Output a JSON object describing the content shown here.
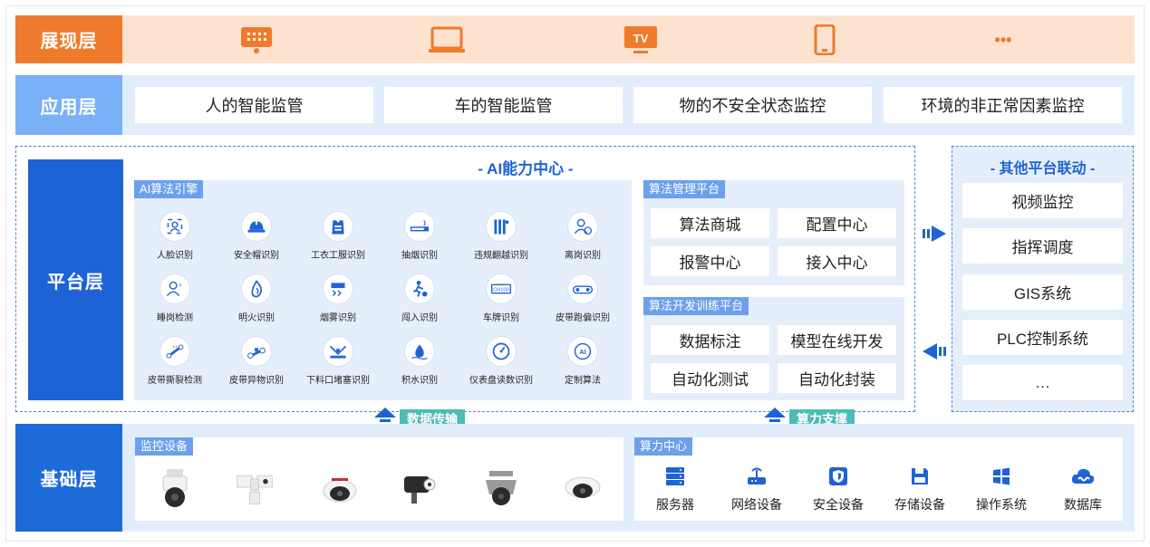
{
  "layers": {
    "presentation": "展现层",
    "application": "应用层",
    "platform": "平台层",
    "foundation": "基础层"
  },
  "presentation_devices": [
    "large-screen-icon",
    "laptop-icon",
    "tv-icon",
    "phone-icon",
    "more-icon"
  ],
  "presentation_tv_text": "TV",
  "presentation_more_text": "•••",
  "application_items": [
    "人的智能监管",
    "车的智能监管",
    "物的不安全状态监控",
    "环境的非正常因素监控"
  ],
  "ai_center": {
    "title": "- AI能力中心 -",
    "engine": {
      "tag": "AI算法引擎",
      "items": [
        "人脸识别",
        "安全帽识别",
        "工衣工服识别",
        "抽烟识别",
        "违规翻越识别",
        "离岗识别",
        "睡岗检测",
        "明火识别",
        "烟雾识别",
        "闯入识别",
        "车牌识别",
        "皮带跑偏识别",
        "皮带撕裂检测",
        "皮带异物识别",
        "下料口堵塞识别",
        "积水识别",
        "仪表盘读数识别",
        "定制算法"
      ],
      "plate_text": "CH100",
      "custom_text": "AI"
    },
    "management": {
      "tag": "算法管理平台",
      "items": [
        "算法商城",
        "配置中心",
        "报警中心",
        "接入中心"
      ]
    },
    "training": {
      "tag": "算法开发训练平台",
      "items": [
        "数据标注",
        "模型在线开发",
        "自动化测试",
        "自动化封装"
      ]
    }
  },
  "other_platforms": {
    "title": "- 其他平台联动 -",
    "items": [
      "视频监控",
      "指挥调度",
      "GIS系统",
      "PLC控制系统",
      "…"
    ]
  },
  "flows": {
    "data_transfer": "数据传输",
    "compute_support": "算力支撑"
  },
  "foundation": {
    "monitor_tag": "监控设备",
    "cameras": [
      "ptz-dome-camera",
      "pan-tilt-camera",
      "dome-camera",
      "bullet-camera",
      "explosion-proof-camera",
      "mini-dome-camera"
    ],
    "compute_tag": "算力中心",
    "compute_items": [
      "服务器",
      "网络设备",
      "安全设备",
      "存储设备",
      "操作系统",
      "数据库"
    ]
  },
  "colors": {
    "presentation": "#ef7a2c",
    "application": "#79b0f6",
    "platform": "#1e63d6",
    "foundation": "#1c6bd8",
    "accent_teal": "#4dbbb6"
  }
}
